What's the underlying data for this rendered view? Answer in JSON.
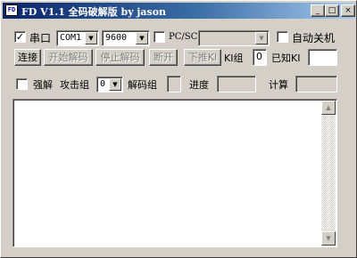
{
  "window": {
    "icon_text": "FD",
    "title": "FD V1.1 全码破解版 by jason",
    "controls": {
      "minimize": "_",
      "maximize": "□",
      "close": "×"
    }
  },
  "row1": {
    "serial_checkbox_checked": true,
    "serial_label": "串口",
    "port_value": "COM1",
    "baud_value": "9600",
    "pcsc_checkbox_checked": false,
    "pcsc_label": "PC/SC",
    "pcsc_reader_value": "",
    "auto_shutdown_checkbox_checked": false,
    "auto_shutdown_label": "自动关机"
  },
  "row2": {
    "connect_label": "连接",
    "start_decode_label": "开始解码",
    "stop_decode_label": "停止解码",
    "disconnect_label": "断开",
    "push_ki_label": "下推KI",
    "ki_group_label": "KI组",
    "ki_group_value": "0",
    "known_ki_label": "已知KI",
    "known_ki_value": ""
  },
  "row3": {
    "force_decode_checkbox_checked": false,
    "force_decode_label": "强解",
    "attack_group_label": "攻击组",
    "attack_group_value": "0",
    "decode_group_label": "解码组",
    "decode_group_value": "",
    "progress_label": "进度",
    "progress_value": "",
    "count_label": "计算",
    "count_value": ""
  },
  "output": {
    "text": ""
  },
  "icons": {
    "combo_arrow": "▼",
    "scroll_up": "▲",
    "scroll_down": "▼",
    "check": "✓"
  }
}
